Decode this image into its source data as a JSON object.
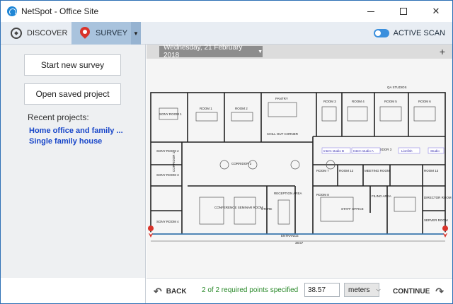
{
  "window": {
    "title": "NetSpot - Office Site"
  },
  "toolbar": {
    "discover_label": "DISCOVER",
    "survey_label": "SURVEY",
    "active_scan_label": "ACTIVE SCAN",
    "active_scan_on": true
  },
  "left_panel": {
    "new_survey_label": "Start new survey",
    "open_project_label": "Open saved project",
    "recent_heading": "Recent projects:",
    "recent_projects": [
      {
        "label": "Home office and family ..."
      },
      {
        "label": "Single family house"
      }
    ]
  },
  "map": {
    "date_label": "Wednesday, 21 February 2018",
    "add_label": "+",
    "labels": {
      "pantry": "PANTRY",
      "chill": "CHILL OUT CORNER",
      "corridor2": "CORRIDOR 2",
      "corridor1": "CORRIDOR 1",
      "corridor3": "CORRIDOR 3",
      "reception": "RECEPTION AREA",
      "conference": "CONFERENCE SEMINAR ROOM",
      "store": "STORE",
      "staff": "STAFF OFFICE",
      "filing": "FILING AREA",
      "director": "DIRECTOR ROOM",
      "server": "SERVER ROOM",
      "meeting": "MEETING ROOM",
      "entrance": "ENTRANCE",
      "dimension": "38.57",
      "room1": "ROOM 1",
      "room2": "ROOM 2",
      "room3": "ROOM 3",
      "room4": "ROOM 4",
      "room5": "ROOM 5",
      "room6": "ROOM 6",
      "room7": "ROOM 7",
      "room8": "ROOM 8",
      "room12": "ROOM 12",
      "room13": "ROOM 13",
      "sony1": "SONY ROOM 1",
      "sony2": "SONY ROOM 2",
      "sony3": "SONY ROOM 3",
      "sony4": "SONY ROOM 4",
      "studio1": "Intern studio B",
      "studio2": "Intern studio A",
      "studio3": "Lionfish",
      "studio4": "Studio",
      "qa": "QA STUDIOS"
    }
  },
  "footer": {
    "back_label": "BACK",
    "status_text": "2 of 2 required points specified",
    "distance_value": "38.57",
    "unit_value": "meters",
    "continue_label": "CONTINUE"
  },
  "colors": {
    "accent": "#3a8fdd",
    "survey_tab": "#a9c3dd",
    "link": "#1846c9",
    "status_ok": "#2b8a2b",
    "pin": "#d9332a"
  }
}
